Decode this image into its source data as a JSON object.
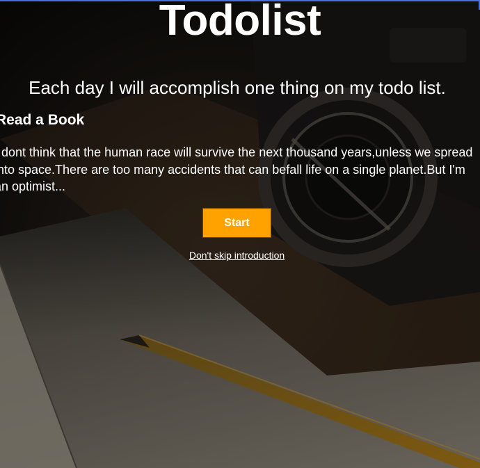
{
  "header": {
    "title": "Todolist",
    "subtitle": "Each day I will accomplish one thing on my todo list."
  },
  "task": {
    "title": "Read a Book",
    "quote": "I dont think that the human race will survive the next thousand years,unless we spread into space.There are too many accidents that can befall life on a single planet.But I'm an optimist..."
  },
  "actions": {
    "start_label": "Start",
    "skip_label": "Don't skip introduction"
  },
  "colors": {
    "accent": "#ffa200",
    "text": "#ffffff",
    "background": "#0e0d0c"
  }
}
